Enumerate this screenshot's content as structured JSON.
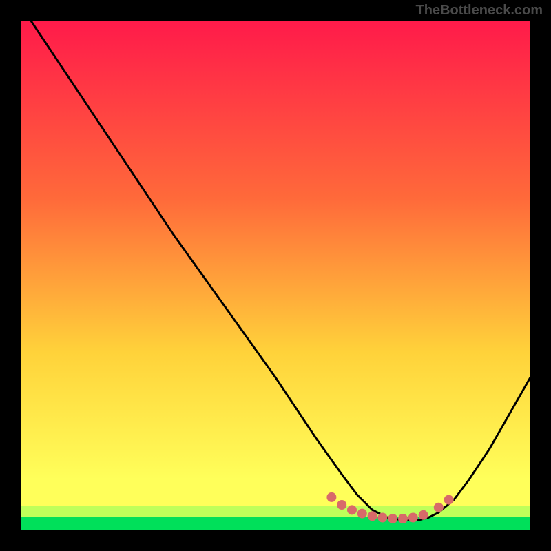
{
  "watermark": "TheBottleneck.com",
  "chart_data": {
    "type": "line",
    "title": "",
    "xlabel": "",
    "ylabel": "",
    "xlim": [
      0,
      100
    ],
    "ylim": [
      0,
      100
    ],
    "gradient_colors": {
      "top": "#ff1a4a",
      "upper_mid": "#ff6a3a",
      "mid": "#ffd23a",
      "lower": "#ffff5a",
      "bottom_band": "#00e05a"
    },
    "series": [
      {
        "name": "bottleneck-curve",
        "color": "#000000",
        "x": [
          2,
          10,
          20,
          30,
          40,
          50,
          58,
          63,
          66,
          69,
          72,
          75,
          78,
          80,
          82,
          85,
          88,
          92,
          96,
          100
        ],
        "y": [
          100,
          88,
          73,
          58,
          44,
          30,
          18,
          11,
          7,
          4,
          2.5,
          2,
          2,
          2.5,
          3.5,
          6,
          10,
          16,
          23,
          30
        ]
      }
    ],
    "markers": {
      "name": "highlight-dots",
      "color": "#d86a6a",
      "points": [
        {
          "x": 61,
          "y": 6.5
        },
        {
          "x": 63,
          "y": 5.0
        },
        {
          "x": 65,
          "y": 4.0
        },
        {
          "x": 67,
          "y": 3.3
        },
        {
          "x": 69,
          "y": 2.8
        },
        {
          "x": 71,
          "y": 2.5
        },
        {
          "x": 73,
          "y": 2.3
        },
        {
          "x": 75,
          "y": 2.3
        },
        {
          "x": 77,
          "y": 2.5
        },
        {
          "x": 79,
          "y": 3.0
        },
        {
          "x": 82,
          "y": 4.5
        },
        {
          "x": 84,
          "y": 6.0
        }
      ]
    }
  }
}
